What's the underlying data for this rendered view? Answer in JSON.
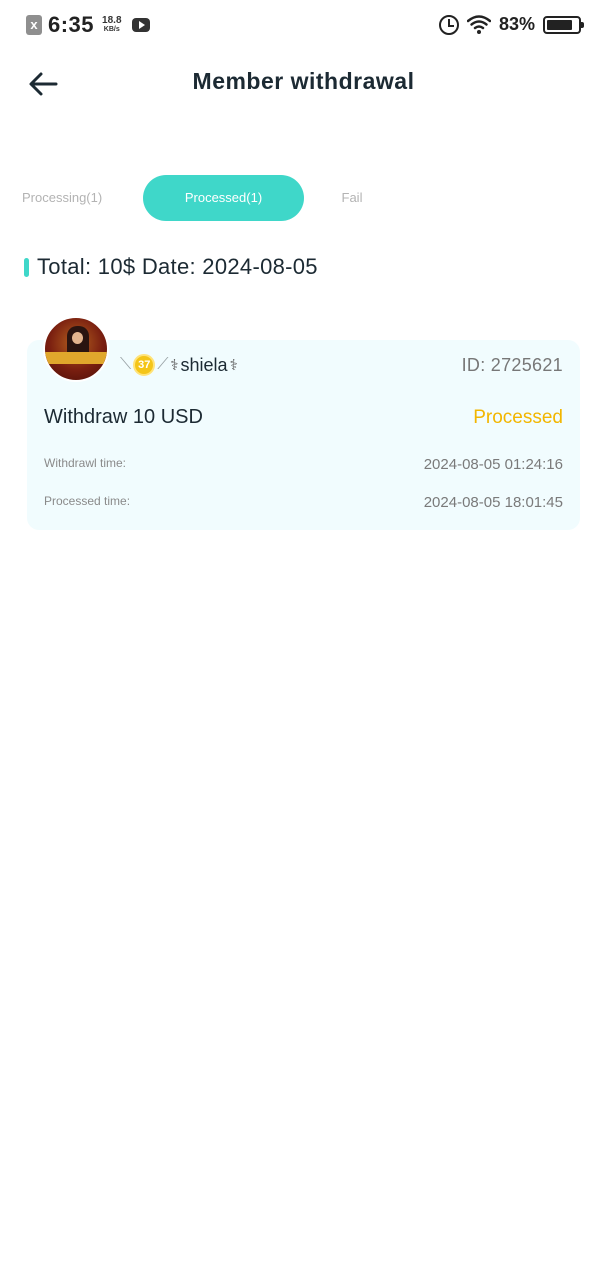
{
  "status_bar": {
    "close_glyph": "x",
    "time": "6:35",
    "speed_value": "18.8",
    "speed_unit": "KB/s",
    "battery_percent": "83%",
    "battery_level": 0.83,
    "icons": [
      "notification-x-icon",
      "youtube-icon",
      "alarm-icon",
      "wifi-icon",
      "battery-icon"
    ]
  },
  "header": {
    "title": "Member withdrawal",
    "back_icon": "arrow-left-icon"
  },
  "tabs": [
    {
      "label": "Processing(1)",
      "active": false
    },
    {
      "label": "Processed(1)",
      "active": true
    },
    {
      "label": "Fail",
      "active": false
    }
  ],
  "summary": {
    "text": "Total: 10$ Date: 2024-08-05"
  },
  "record": {
    "level": "37",
    "username": "shiela",
    "user_id": "ID: 2725621",
    "amount": "Withdraw 10 USD",
    "status": "Processed",
    "withdrawal_time_label": "Withdrawl time:",
    "withdrawal_time": "2024-08-05 01:24:16",
    "processed_time_label": "Processed time:",
    "processed_time": "2024-08-05 18:01:45"
  },
  "colors": {
    "accent": "#3fd7c9",
    "status_processed": "#f2b600",
    "card_bg": "#f1fcfe"
  }
}
